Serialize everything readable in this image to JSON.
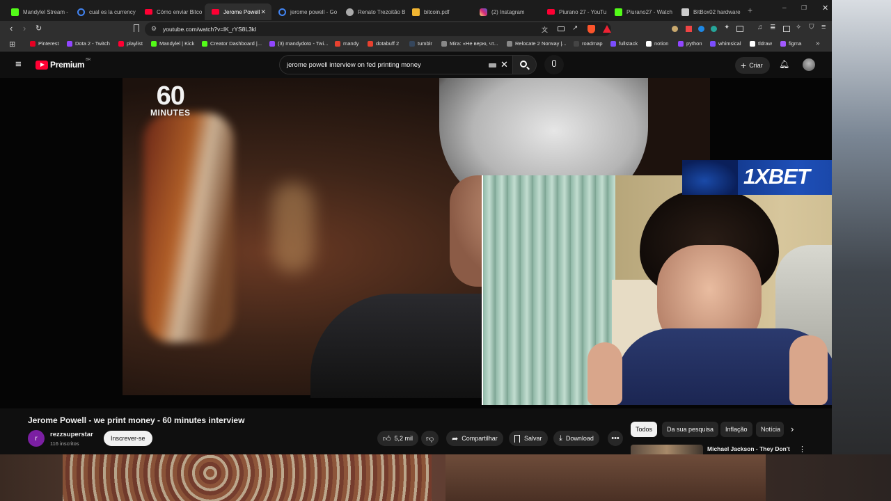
{
  "tabs": [
    {
      "title": "Mandylel Stream -",
      "icon": "kick-icon",
      "color": "#53fc18"
    },
    {
      "title": "cual es la currency",
      "icon": "google-icon",
      "color": "#ffffff"
    },
    {
      "title": "Cómo enviar Bitco",
      "icon": "youtube-icon",
      "color": "#ff0033"
    },
    {
      "title": "Jerome Powell",
      "icon": "youtube-icon",
      "color": "#ff0033",
      "active": true
    },
    {
      "title": "jerome powell - Go",
      "icon": "google-icon",
      "color": "#ffffff"
    },
    {
      "title": "Renato Trezoitão B",
      "icon": "web-icon",
      "color": "#aaaaaa"
    },
    {
      "title": "bitcoin.pdf",
      "icon": "pdf-icon",
      "color": "#f2b632"
    },
    {
      "title": "(2) Instagram",
      "icon": "instagram-icon",
      "color": "#d62976"
    },
    {
      "title": "Piurano 27 - YouTu",
      "icon": "youtube-icon",
      "color": "#ff0033"
    },
    {
      "title": "Piurano27 - Watch",
      "icon": "kick-icon",
      "color": "#53fc18"
    },
    {
      "title": "BitBox02 hardware",
      "icon": "bitbox-icon",
      "color": "#cccccc"
    }
  ],
  "url": "youtube.com/watch?v=lK_rYS8L3kI",
  "bookmarks": [
    {
      "label": "Pinterest",
      "color": "#e60023"
    },
    {
      "label": "Dota 2 - Twitch",
      "color": "#9146ff"
    },
    {
      "label": "playlist",
      "color": "#ff0033"
    },
    {
      "label": "Mandylel | Kick",
      "color": "#53fc18"
    },
    {
      "label": "Creator Dashboard |...",
      "color": "#53fc18"
    },
    {
      "label": "(3) mandydoto - Twi...",
      "color": "#9146ff"
    },
    {
      "label": "mandy",
      "color": "#e8412f"
    },
    {
      "label": "dotabuff 2",
      "color": "#e8412f"
    },
    {
      "label": "tumblr",
      "color": "#35465c"
    },
    {
      "label": "Mira: «Не верю, чт...",
      "color": "#888888"
    },
    {
      "label": "Relocate 2 Norway |...",
      "color": "#888888"
    },
    {
      "label": "roadmap",
      "color": "#444444"
    },
    {
      "label": "fullstack",
      "color": "#7b4dff"
    },
    {
      "label": "notion",
      "color": "#ffffff"
    },
    {
      "label": "python",
      "color": "#9146ff"
    },
    {
      "label": "whimsical",
      "color": "#7b4dff"
    },
    {
      "label": "tldraw",
      "color": "#ffffff"
    },
    {
      "label": "figma",
      "color": "#a259ff"
    }
  ],
  "youtube": {
    "logo_text": "Premium",
    "badge": "BR",
    "search_value": "jerome powell interview on fed printing money",
    "create_label": "Criar"
  },
  "overlay": {
    "brand_text": "1XBET",
    "tv_logo_line1": "60",
    "tv_logo_line2": "MINUTES"
  },
  "video": {
    "title": "Jerome Powell - we print money - 60 minutes interview",
    "channel": "rezzsuperstar",
    "channel_initial": "r",
    "subscribers": "116 inscritos",
    "subscribe_label": "Inscrever-se",
    "likes": "5,2 mil",
    "share_label": "Compartilhar",
    "save_label": "Salvar",
    "download_label": "Download"
  },
  "filter_chips": [
    "Todos",
    "Da sua pesquisa",
    "Inflação",
    "Notícia"
  ],
  "next_video_title": "Michael Jackson - They Don't",
  "colors": {
    "youtube_red": "#ff0033",
    "background": "#0f0f0f",
    "chip_bg": "#272727"
  }
}
